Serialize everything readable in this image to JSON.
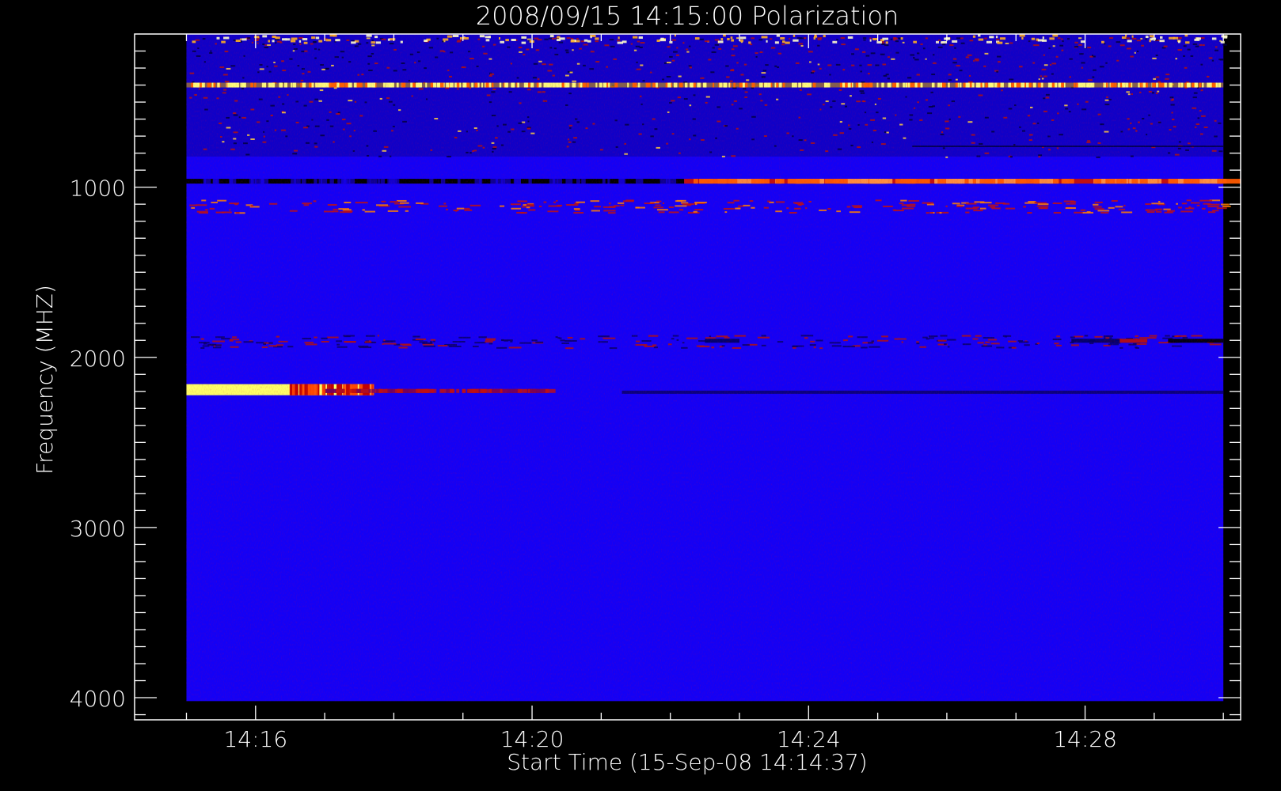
{
  "chart_data": {
    "type": "heatmap",
    "title": "2008/09/15 14:15:00 Polarization",
    "xlabel": "Start Time (15-Sep-08 14:14:37)",
    "ylabel": "Frequency (MHZ)",
    "x_ticks": [
      "14:16",
      "14:20",
      "14:24",
      "14:28"
    ],
    "y_ticks": [
      "1000",
      "2000",
      "3000",
      "4000"
    ],
    "y_tick_values": [
      1000,
      2000,
      3000,
      4000
    ],
    "x_tick_minutes": [
      16,
      20,
      24,
      28
    ],
    "xlim_minutes": [
      14.25,
      30.25
    ],
    "ylim": [
      100,
      4130
    ],
    "data_xlim_minutes": [
      15.0,
      30.0
    ],
    "data_ylim": [
      100,
      4020
    ],
    "y_reversed": true,
    "grid": false,
    "colorscale": [
      "#000000",
      "#1400f5",
      "#cc1010",
      "#ff7a00",
      "#ffff66"
    ],
    "background_level": "blue",
    "features": [
      {
        "name": "bright yellow band",
        "freq_mhz": 2190,
        "t_start_min": 15.0,
        "t_end_min": 17.7,
        "level": "yellow"
      },
      {
        "name": "red fading tail",
        "freq_mhz": 2200,
        "t_start_min": 17.0,
        "t_end_min": 20.2,
        "level": "red"
      },
      {
        "name": "dark blue band",
        "freq_mhz": 2205,
        "t_start_min": 21.3,
        "t_end_min": 30.0,
        "level": "dark"
      },
      {
        "name": "yellow speckle band",
        "freq_mhz": 400,
        "t_start_min": 15.0,
        "t_end_min": 30.0,
        "level": "yellow"
      },
      {
        "name": "black band",
        "freq_mhz": 965,
        "t_start_min": 15.0,
        "t_end_min": 22.2,
        "level": "black"
      },
      {
        "name": "orange band",
        "freq_mhz": 965,
        "t_start_min": 22.2,
        "t_end_min": 30.0,
        "level": "orange"
      },
      {
        "name": "red dashed band",
        "freq_mhz": 1110,
        "t_start_min": 15.0,
        "t_end_min": 30.0,
        "level": "red"
      },
      {
        "name": "dark dashes",
        "freq_mhz": 1905,
        "t_start_min": 15.0,
        "t_end_min": 30.0,
        "level": "dark"
      },
      {
        "name": "noisy top region",
        "freq_mhz": 300,
        "t_start_min": 15.0,
        "t_end_min": 30.0,
        "level": "mixed"
      }
    ]
  }
}
